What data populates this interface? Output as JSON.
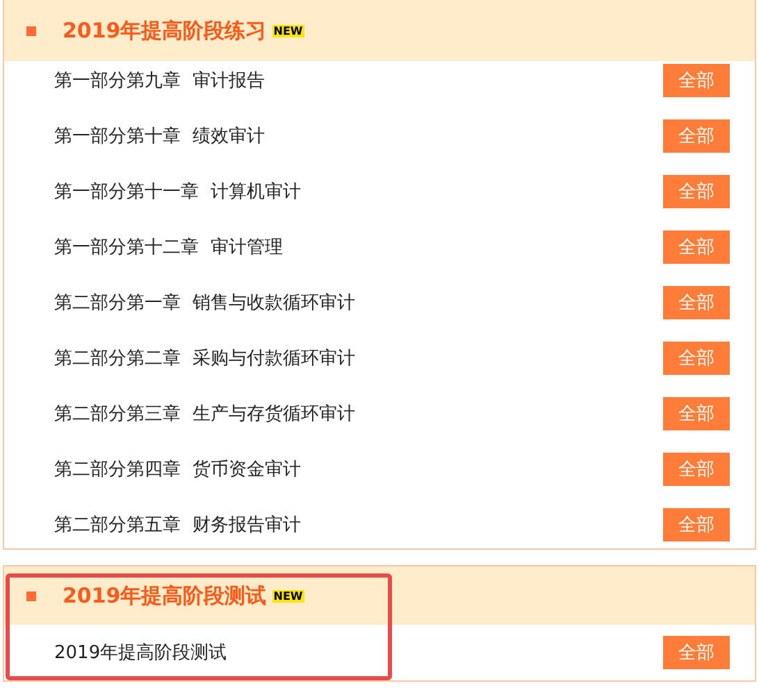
{
  "sections": [
    {
      "title": "2019年提高阶段练习",
      "badge": "NEW",
      "highlighted": false,
      "items": [
        {
          "label": "第一部分第九章  审计报告",
          "button": "全部"
        },
        {
          "label": "第一部分第十章  绩效审计",
          "button": "全部"
        },
        {
          "label": "第一部分第十一章  计算机审计",
          "button": "全部"
        },
        {
          "label": "第一部分第十二章  审计管理",
          "button": "全部"
        },
        {
          "label": "第二部分第一章  销售与收款循环审计",
          "button": "全部"
        },
        {
          "label": "第二部分第二章  采购与付款循环审计",
          "button": "全部"
        },
        {
          "label": "第二部分第三章  生产与存货循环审计",
          "button": "全部"
        },
        {
          "label": "第二部分第四章  货币资金审计",
          "button": "全部"
        },
        {
          "label": "第二部分第五章  财务报告审计",
          "button": "全部"
        }
      ]
    },
    {
      "title": "2019年提高阶段测试",
      "badge": "NEW",
      "highlighted": true,
      "items": [
        {
          "label": "2019年提高阶段测试",
          "button": "全部"
        }
      ]
    }
  ]
}
